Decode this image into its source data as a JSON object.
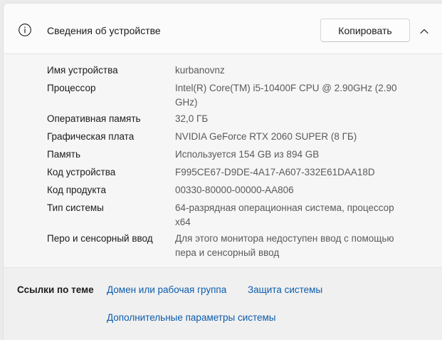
{
  "header": {
    "title": "Сведения об устройстве",
    "copy_label": "Копировать",
    "info_icon": "info-icon",
    "collapse_icon": "chevron-up-icon"
  },
  "specs": [
    {
      "label": "Имя устройства",
      "value": "kurbanovnz"
    },
    {
      "label": "Процессор",
      "value": "Intel(R) Core(TM) i5-10400F CPU @ 2.90GHz (2.90 GHz)"
    },
    {
      "label": "Оперативная память",
      "value": "32,0 ГБ"
    },
    {
      "label": "Графическая плата",
      "value": "NVIDIA GeForce RTX 2060 SUPER (8 ГБ)"
    },
    {
      "label": "Память",
      "value": "Используется 154 GB из 894 GB"
    },
    {
      "label": "Код устройства",
      "value": "F995CE67-D9DE-4A17-A607-332E61DAA18D"
    },
    {
      "label": "Код продукта",
      "value": "00330-80000-00000-AA806"
    },
    {
      "label": "Тип системы",
      "value": "64-разрядная операционная система, процессор x64"
    },
    {
      "label": "Перо и сенсорный ввод",
      "value": "Для этого монитора недоступен ввод с помощью пера и сенсорный ввод"
    }
  ],
  "related": {
    "label": "Ссылки по теме",
    "links": [
      "Домен или рабочая группа",
      "Защита системы",
      "Дополнительные параметры системы"
    ]
  },
  "colors": {
    "link": "#0b5cad",
    "value_text": "#5a5a5a",
    "label_text": "#1b1b1b"
  }
}
